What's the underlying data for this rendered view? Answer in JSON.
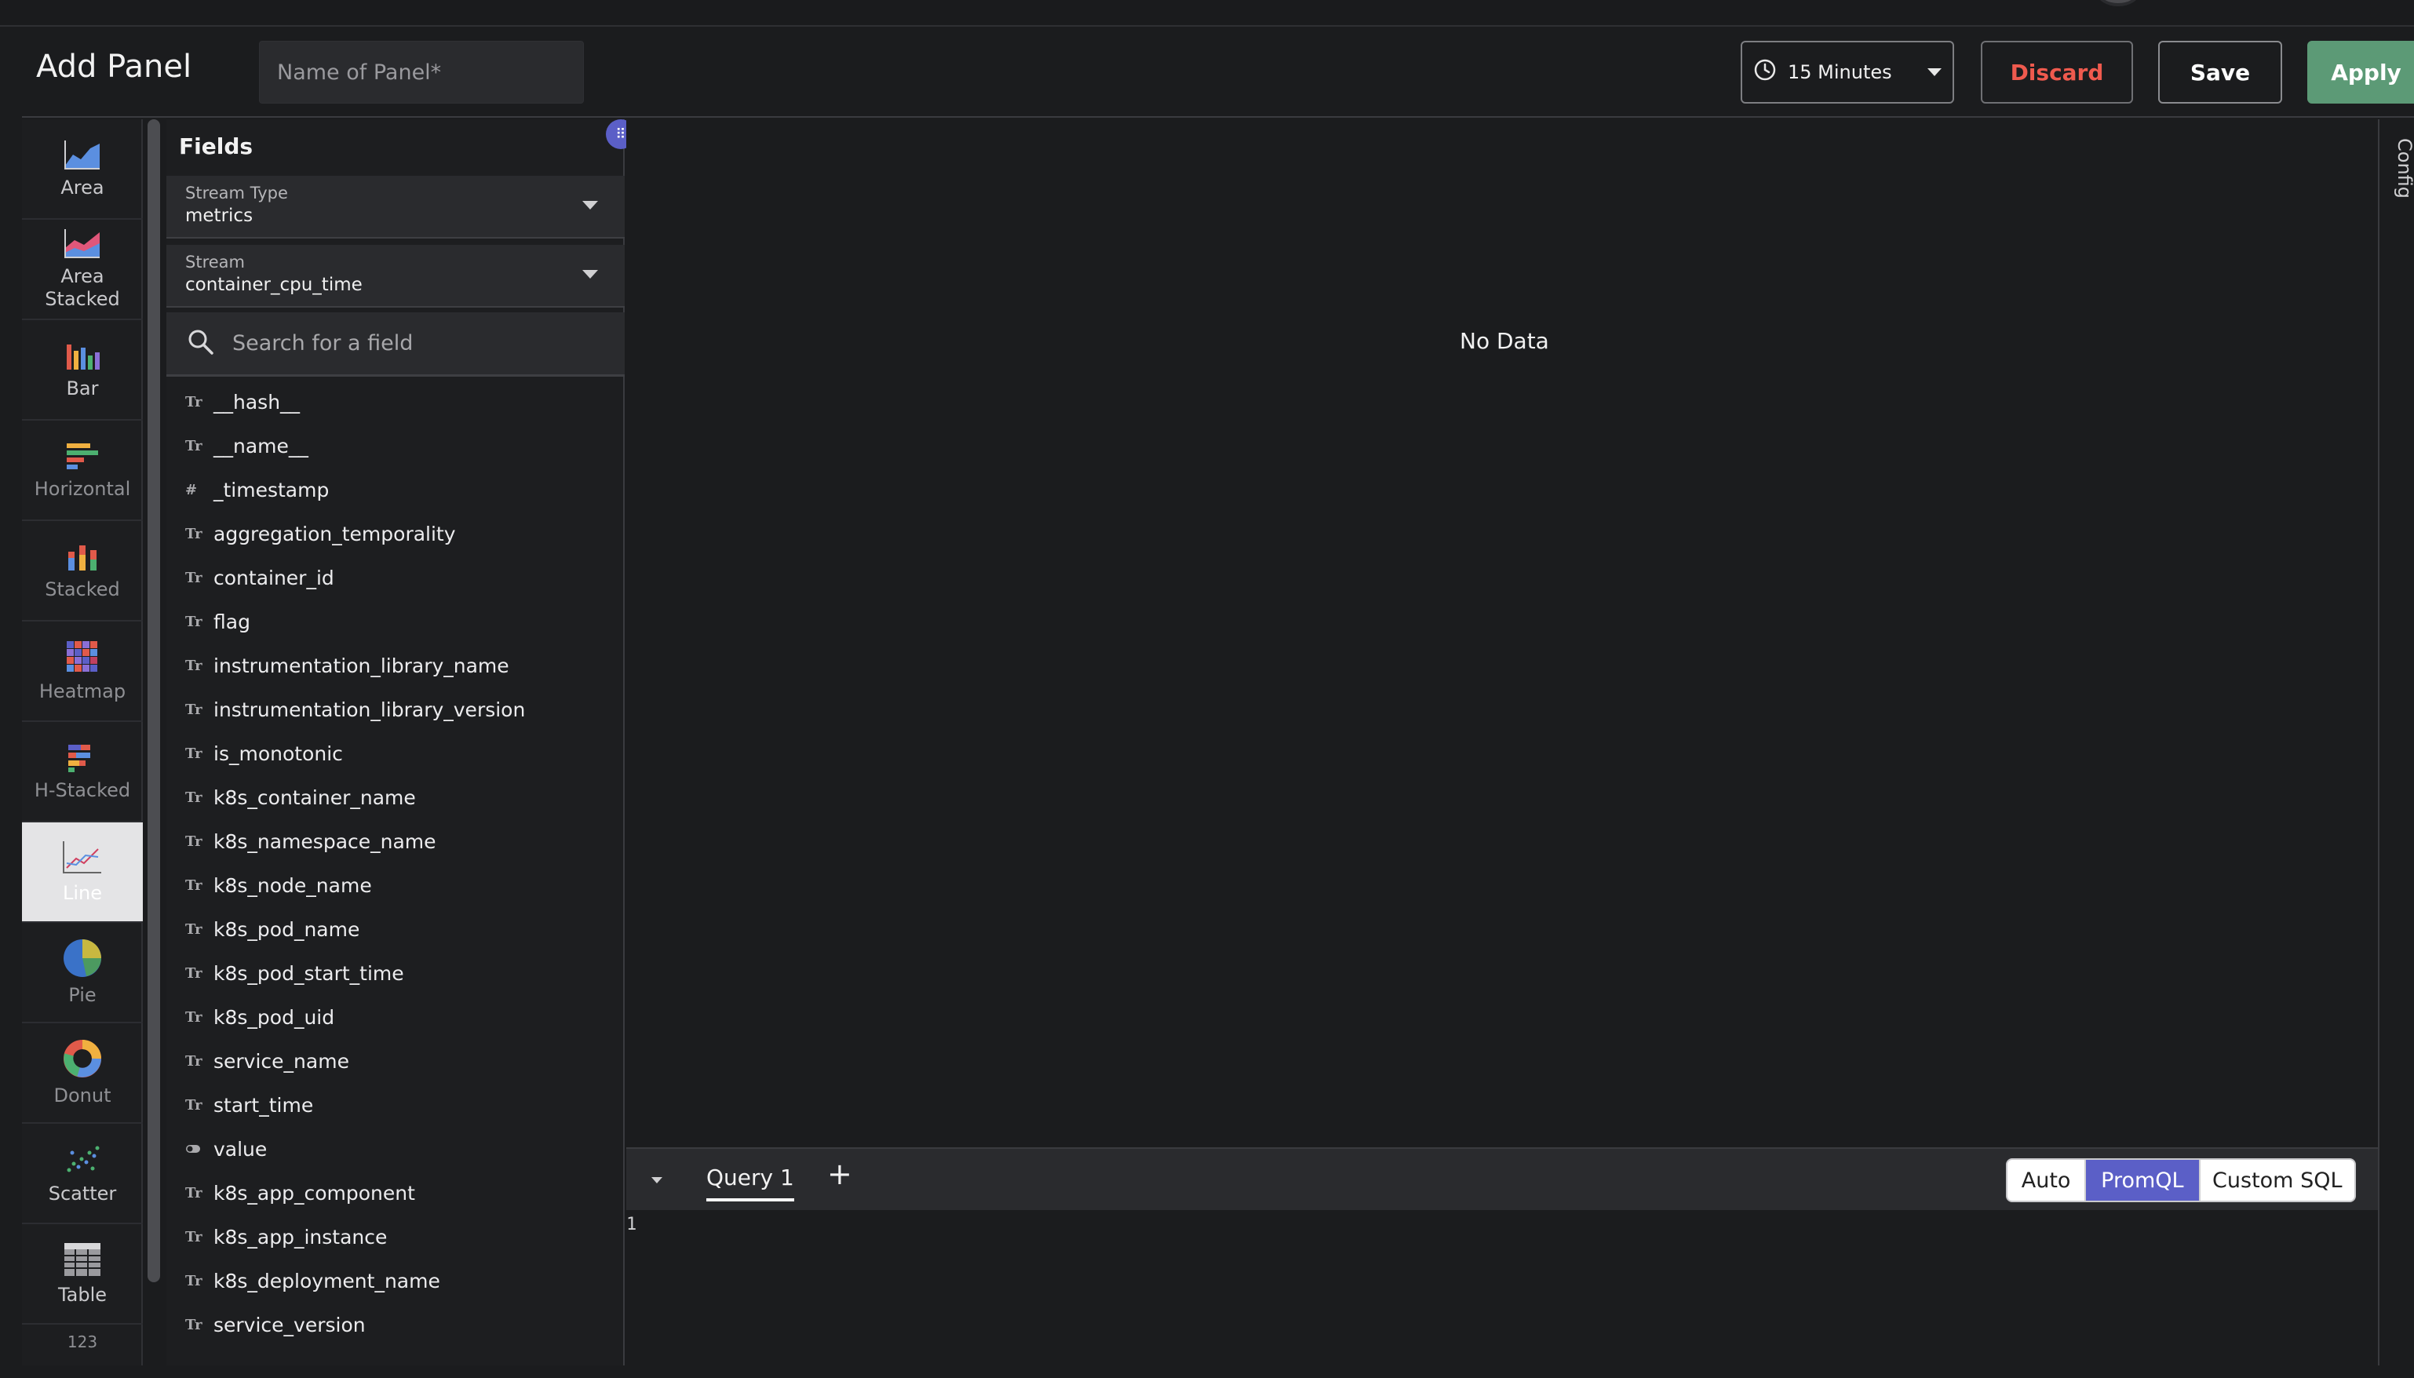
{
  "header": {
    "title": "Add Panel",
    "panel_name_placeholder": "Name of Panel*",
    "time_range": "15 Minutes",
    "discard_label": "Discard",
    "save_label": "Save",
    "apply_label": "Apply"
  },
  "chart_types": [
    {
      "label": "Area",
      "icon": "area-chart-icon"
    },
    {
      "label": "Area\nStacked",
      "icon": "area-stacked-chart-icon"
    },
    {
      "label": "Bar",
      "icon": "bar-chart-icon"
    },
    {
      "label": "Horizontal",
      "icon": "horizontal-bar-chart-icon"
    },
    {
      "label": "Stacked",
      "icon": "stacked-bar-chart-icon"
    },
    {
      "label": "Heatmap",
      "icon": "heatmap-chart-icon"
    },
    {
      "label": "H-Stacked",
      "icon": "h-stacked-chart-icon"
    },
    {
      "label": "Line",
      "icon": "line-chart-icon",
      "selected": true
    },
    {
      "label": "Pie",
      "icon": "pie-chart-icon"
    },
    {
      "label": "Donut",
      "icon": "donut-chart-icon"
    },
    {
      "label": "Scatter",
      "icon": "scatter-chart-icon"
    },
    {
      "label": "Table",
      "icon": "table-chart-icon"
    }
  ],
  "fields_panel": {
    "title": "Fields",
    "stream_type": {
      "label": "Stream Type",
      "value": "metrics"
    },
    "stream": {
      "label": "Stream",
      "value": "container_cpu_time"
    },
    "search_placeholder": "Search for a field",
    "fields": [
      {
        "name": "__hash__",
        "type": "Tr"
      },
      {
        "name": "__name__",
        "type": "Tr"
      },
      {
        "name": "_timestamp",
        "type": "#"
      },
      {
        "name": "aggregation_temporality",
        "type": "Tr"
      },
      {
        "name": "container_id",
        "type": "Tr"
      },
      {
        "name": "flag",
        "type": "Tr"
      },
      {
        "name": "instrumentation_library_name",
        "type": "Tr"
      },
      {
        "name": "instrumentation_library_version",
        "type": "Tr"
      },
      {
        "name": "is_monotonic",
        "type": "Tr"
      },
      {
        "name": "k8s_container_name",
        "type": "Tr"
      },
      {
        "name": "k8s_namespace_name",
        "type": "Tr"
      },
      {
        "name": "k8s_node_name",
        "type": "Tr"
      },
      {
        "name": "k8s_pod_name",
        "type": "Tr"
      },
      {
        "name": "k8s_pod_start_time",
        "type": "Tr"
      },
      {
        "name": "k8s_pod_uid",
        "type": "Tr"
      },
      {
        "name": "service_name",
        "type": "Tr"
      },
      {
        "name": "start_time",
        "type": "Tr"
      },
      {
        "name": "value",
        "type": "toggle"
      },
      {
        "name": "k8s_app_component",
        "type": "Tr"
      },
      {
        "name": "k8s_app_instance",
        "type": "Tr"
      },
      {
        "name": "k8s_deployment_name",
        "type": "Tr"
      },
      {
        "name": "service_version",
        "type": "Tr"
      }
    ]
  },
  "chart_area": {
    "empty_text": "No Data",
    "config_label": "Config"
  },
  "query": {
    "tab_label": "Query 1",
    "add_label": "+",
    "modes": [
      "Auto",
      "PromQL",
      "Custom SQL"
    ],
    "active_mode": "PromQL",
    "editor_line": "1"
  },
  "colors": {
    "accent": "#5b5fc7",
    "apply_green": "#5c9a76",
    "discard_red": "#ef5a4e"
  }
}
